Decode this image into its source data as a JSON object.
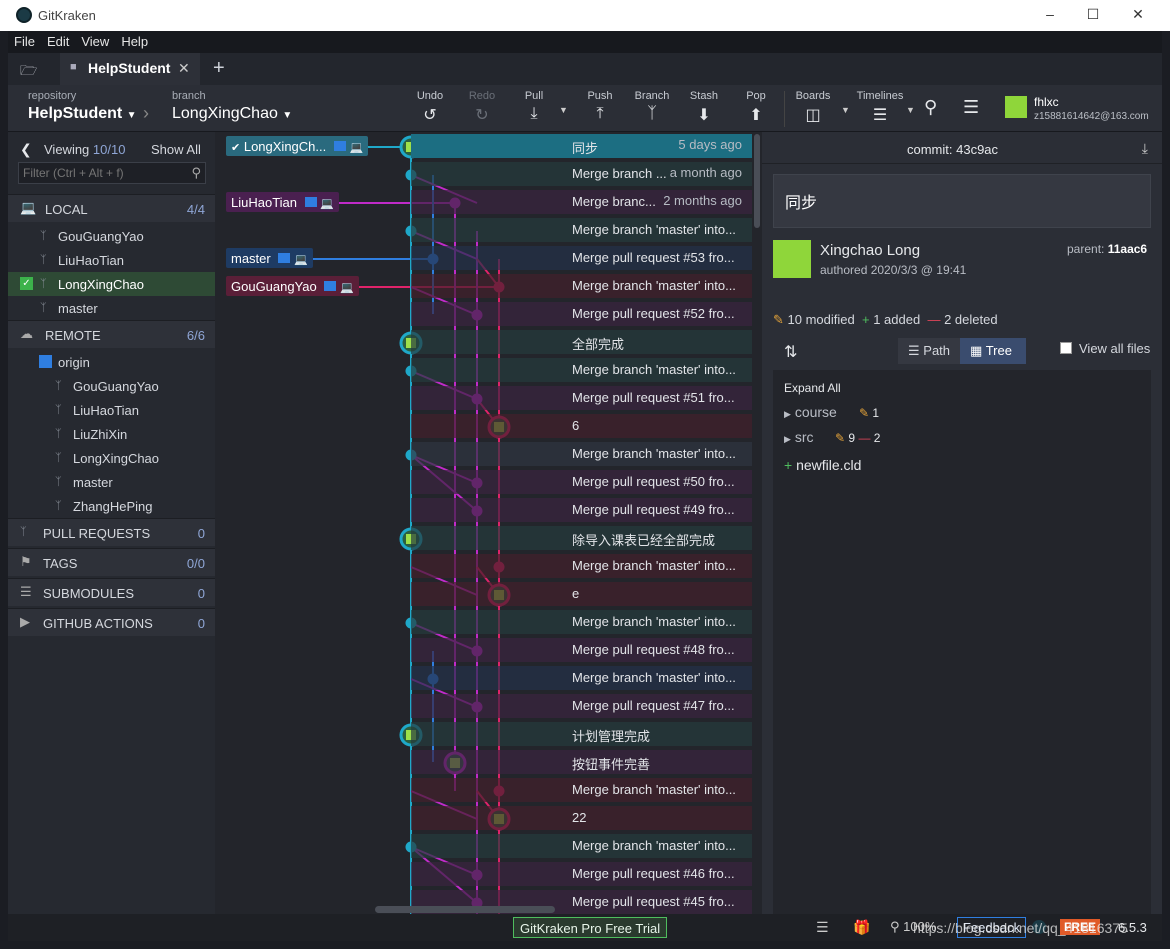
{
  "window": {
    "title": "GitKraken"
  },
  "menu": [
    "File",
    "Edit",
    "View",
    "Help"
  ],
  "tab": {
    "label": "HelpStudent"
  },
  "toolbar": {
    "repo_caption": "repository",
    "repo_name": "HelpStudent",
    "branch_caption": "branch",
    "branch_name": "LongXingChao",
    "buttons": {
      "undo": "Undo",
      "redo": "Redo",
      "pull": "Pull",
      "push": "Push",
      "branch": "Branch",
      "stash": "Stash",
      "pop": "Pop",
      "boards": "Boards",
      "timelines": "Timelines"
    },
    "user_name": "fhlxc",
    "user_email": "z15881614642@163.com"
  },
  "sidebar": {
    "viewing_label": "Viewing",
    "viewing_count": "10/10",
    "show_all": "Show All",
    "filter_placeholder": "Filter (Ctrl + Alt + f)",
    "local_label": "LOCAL",
    "local_count": "4/4",
    "local_branches": [
      "GouGuangYao",
      "LiuHaoTian",
      "LongXingChao",
      "master"
    ],
    "remote_label": "REMOTE",
    "remote_count": "6/6",
    "remote_name": "origin",
    "remote_branches": [
      "GouGuangYao",
      "LiuHaoTian",
      "LiuZhiXin",
      "LongXingChao",
      "master",
      "ZhangHePing"
    ],
    "pull_requests": "PULL REQUESTS",
    "pull_requests_count": "0",
    "tags": "TAGS",
    "tags_count": "0/0",
    "submodules": "SUBMODULES",
    "submodules_count": "0",
    "github_actions": "GITHUB ACTIONS",
    "github_actions_count": "0"
  },
  "graph": {
    "refs": {
      "r0": "LongXingCh...",
      "r2": "LiuHaoTian",
      "r4": "master",
      "r5": "GouGuangYao"
    },
    "commits": [
      {
        "msg": "同步",
        "time": "5 days ago"
      },
      {
        "msg": "Merge branch ...",
        "time": "a month ago"
      },
      {
        "msg": "Merge branc...",
        "time": "2 months ago"
      },
      {
        "msg": "Merge branch 'master' into...",
        "time": ""
      },
      {
        "msg": "Merge pull request #53 fro...",
        "time": ""
      },
      {
        "msg": "Merge branch 'master' into...",
        "time": ""
      },
      {
        "msg": "Merge pull request #52 fro...",
        "time": ""
      },
      {
        "msg": "全部完成",
        "time": ""
      },
      {
        "msg": "Merge branch 'master' into...",
        "time": ""
      },
      {
        "msg": "Merge pull request #51 fro...",
        "time": ""
      },
      {
        "msg": "6",
        "time": ""
      },
      {
        "msg": "Merge branch 'master' into...",
        "time": ""
      },
      {
        "msg": "Merge pull request #50 fro...",
        "time": ""
      },
      {
        "msg": "Merge pull request #49 fro...",
        "time": ""
      },
      {
        "msg": "除导入课表已经全部完成",
        "time": ""
      },
      {
        "msg": "Merge branch 'master' into...",
        "time": ""
      },
      {
        "msg": "e",
        "time": ""
      },
      {
        "msg": "Merge branch 'master' into...",
        "time": ""
      },
      {
        "msg": "Merge pull request #48 fro...",
        "time": ""
      },
      {
        "msg": "Merge branch 'master' into...",
        "time": ""
      },
      {
        "msg": "Merge pull request #47 fro...",
        "time": ""
      },
      {
        "msg": "计划管理完成",
        "time": ""
      },
      {
        "msg": "按钮事件完善",
        "time": ""
      },
      {
        "msg": "Merge branch 'master' into...",
        "time": ""
      },
      {
        "msg": "22",
        "time": ""
      },
      {
        "msg": "Merge branch 'master' into...",
        "time": ""
      },
      {
        "msg": "Merge pull request #46 fro...",
        "time": ""
      },
      {
        "msg": "Merge pull request #45 fro...",
        "time": ""
      }
    ]
  },
  "detail": {
    "commit_label": "commit: 43c9ac",
    "message": "同步",
    "author": "Xingchao Long",
    "authored": "authored  2020/3/3 @ 19:41",
    "parent_label": "parent:",
    "parent_sha": "11aac6",
    "modified": "10 modified",
    "added": "1 added",
    "deleted": "2 deleted",
    "path_label": "Path",
    "tree_label": "Tree",
    "view_all": "View all files",
    "expand_all": "Expand All",
    "tree": [
      {
        "name": "course",
        "mod": "1",
        "del": ""
      },
      {
        "name": "src",
        "mod": "9",
        "del": "2"
      }
    ],
    "new_file": "newfile.cld"
  },
  "status": {
    "trial": "GitKraken Pro Free Trial",
    "zoom": "100%",
    "feedback": "Feedback",
    "free": "FREE",
    "version": "6.5.3",
    "watermark": "https://blog.csdn.net/qq_41816375"
  },
  "colors": {
    "cyan": "#1fa8c9",
    "magenta": "#c02bc9",
    "pink": "#e0236a",
    "blue": "#2f7ee0"
  }
}
